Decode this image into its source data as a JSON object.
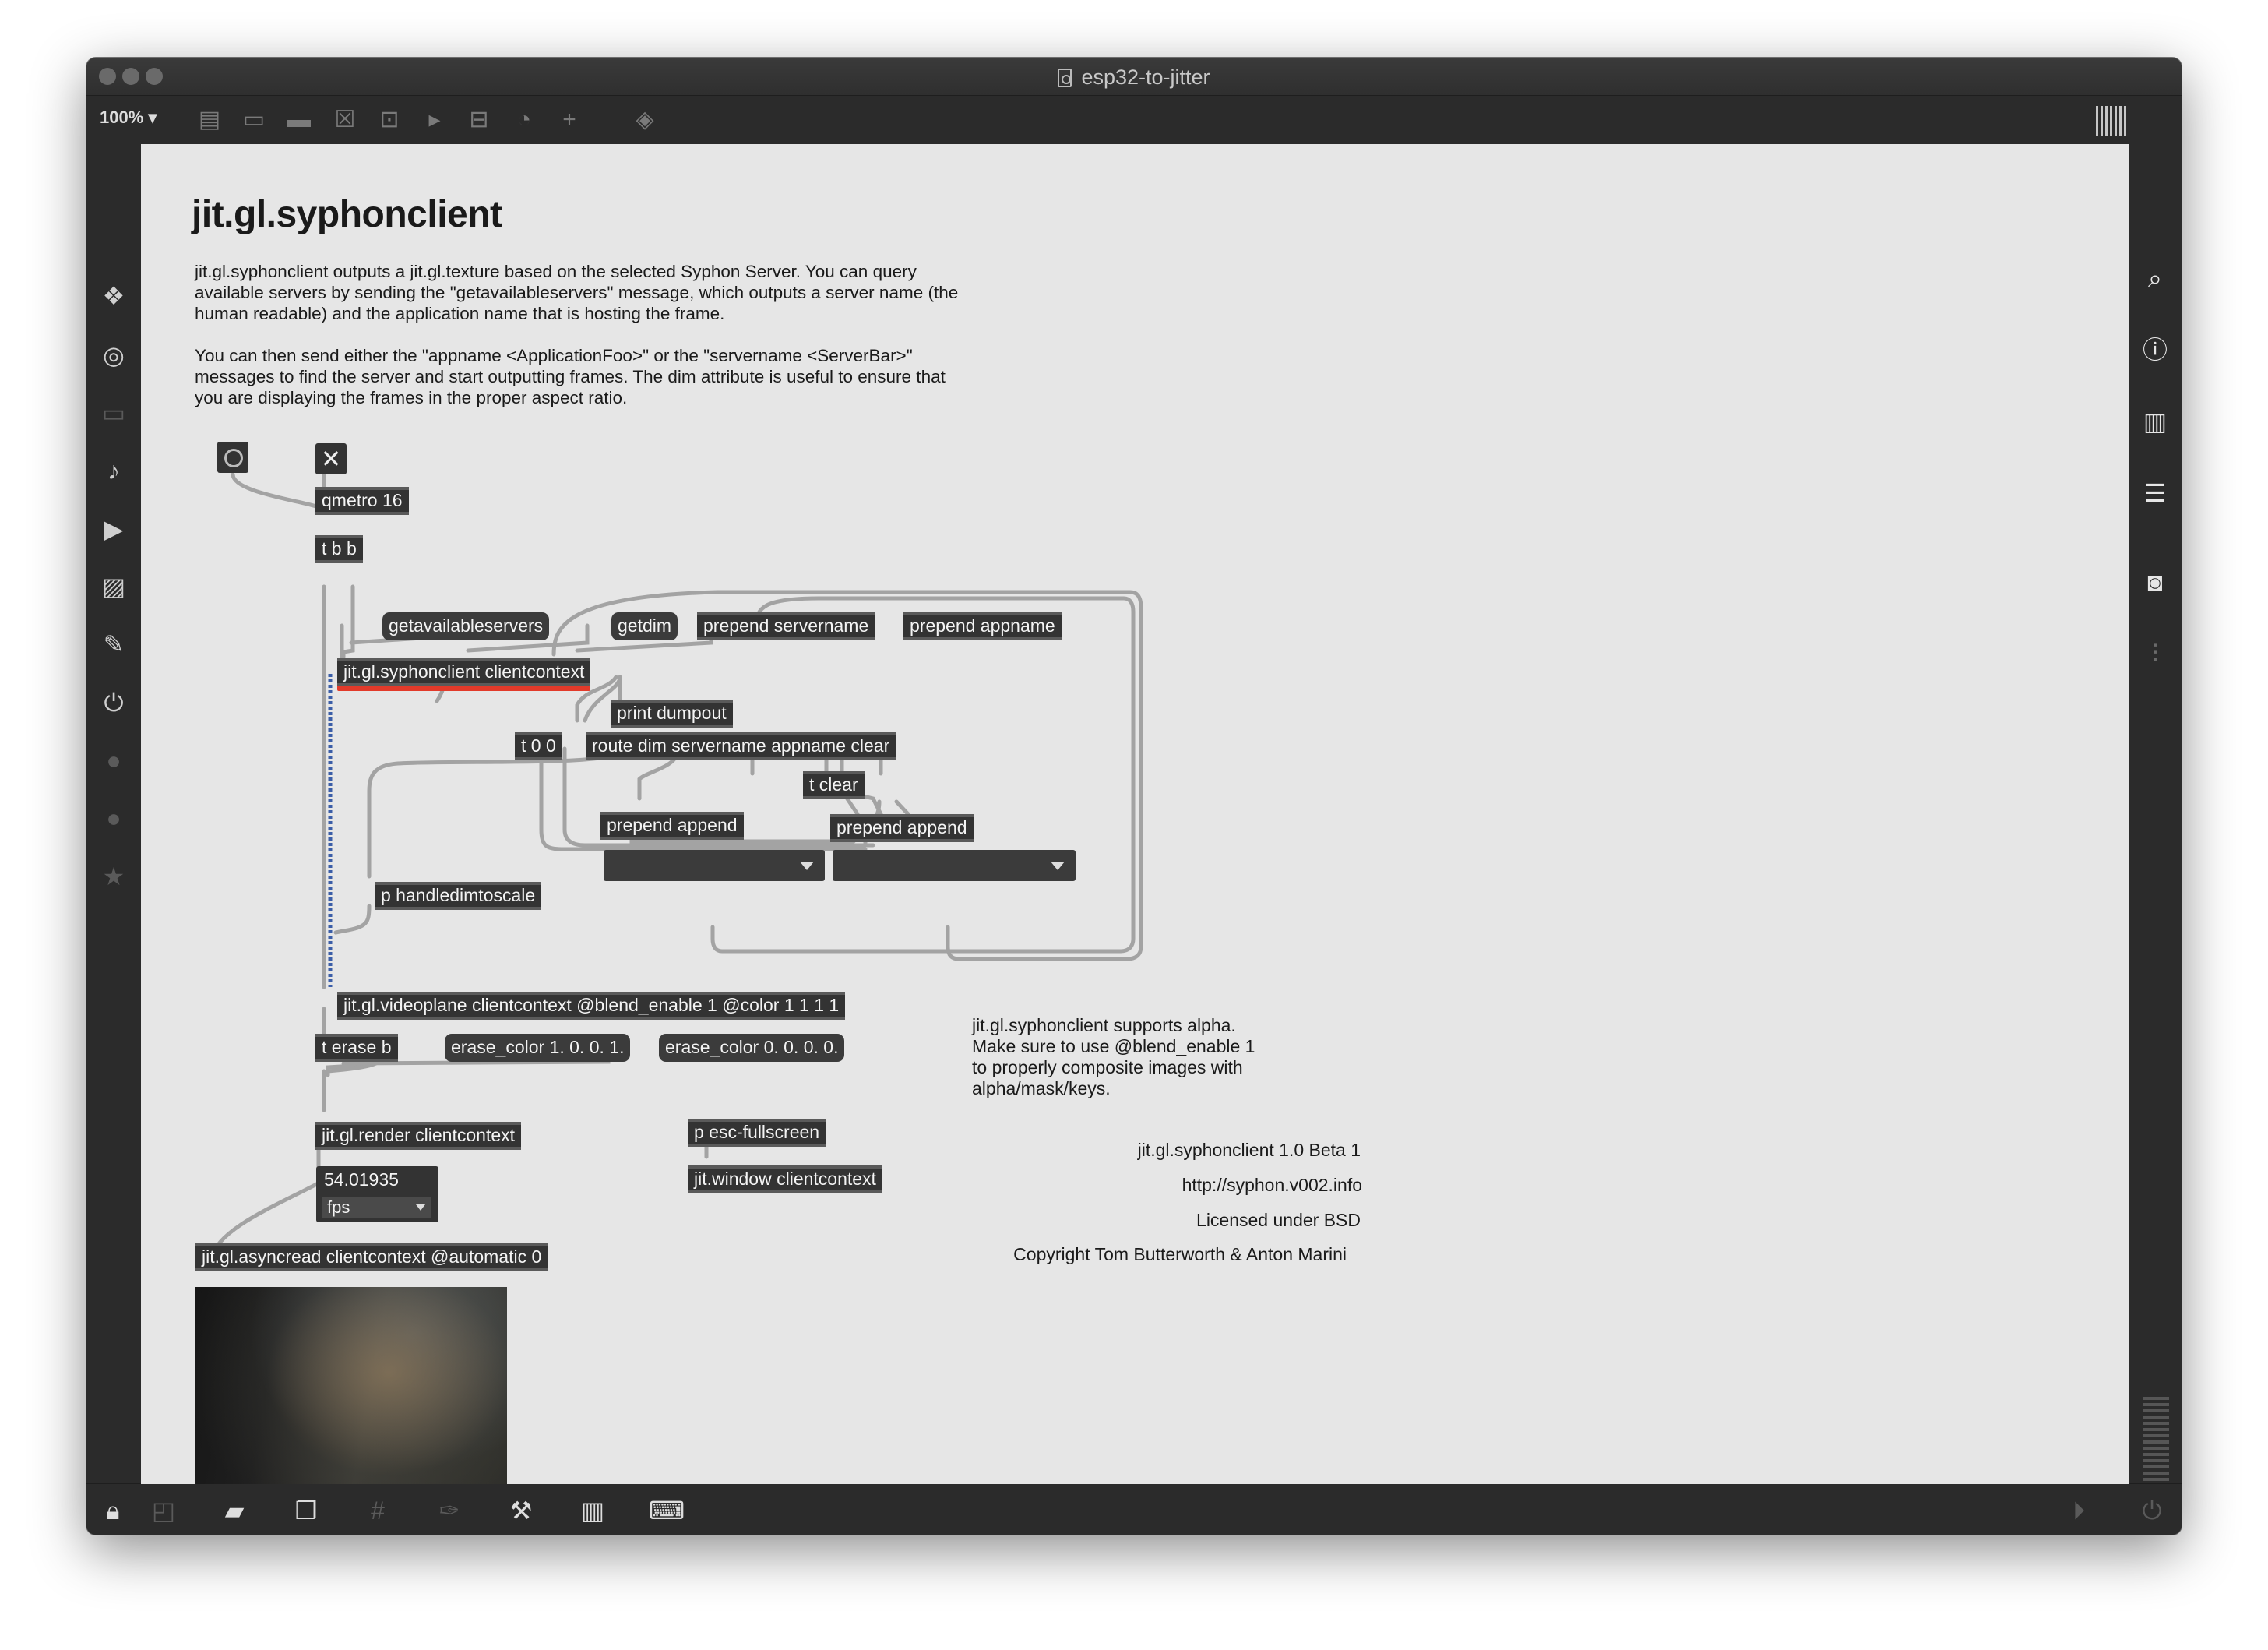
{
  "window": {
    "title": "esp32-to-jitter",
    "zoom": "100%"
  },
  "patcher": {
    "heading": "jit.gl.syphonclient",
    "description_1": "jit.gl.syphonclient outputs a jit.gl.texture based on the selected Syphon Server. You can query available servers by sending the \"getavailableservers\" message, which outputs a server name (the human readable) and the application name that is hosting the frame.",
    "description_2": "You can then send either the \"appname <ApplicationFoo>\" or the \"servername <ServerBar>\" messages to find the server and start outputting frames. The dim attribute is useful to ensure that you are displaying the frames in the proper aspect ratio.",
    "objects": {
      "qmetro": "qmetro 16",
      "tbb": "t b b",
      "getavailableservers": "getavailableservers",
      "getdim": "getdim",
      "prepend_servername": "prepend servername",
      "prepend_appname": "prepend appname",
      "syphonclient": "jit.gl.syphonclient clientcontext",
      "print_dumpout": "print dumpout",
      "t00": "t 0 0",
      "route": "route dim servername appname clear",
      "tclear": "t clear",
      "prepend_append_1": "prepend append",
      "prepend_append_2": "prepend append",
      "handledimtoscale": "p handledimtoscale",
      "videoplane": "jit.gl.videoplane clientcontext @blend_enable 1 @color 1 1 1 1",
      "terase": "t erase b",
      "erase_color_1": "erase_color 1. 0. 0. 1.",
      "erase_color_0": "erase_color 0. 0. 0. 0.",
      "render": "jit.gl.render clientcontext",
      "esc_fullscreen": "p esc-fullscreen",
      "window": "jit.window clientcontext",
      "asyncread": "jit.gl.asyncread clientcontext @automatic 0"
    },
    "fps": {
      "value": "54.01935",
      "unit": "fps"
    },
    "alpha_note": "jit.gl.syphonclient supports alpha.\nMake sure to use @blend_enable 1\nto properly composite images with\nalpha/mask/keys.",
    "credits": {
      "version": "jit.gl.syphonclient 1.0 Beta 1",
      "url": "http://syphon.v002.info",
      "license": "Licensed under BSD",
      "copyright": "Copyright Tom Butterworth & Anton Marini"
    }
  },
  "icons": {
    "left_sidebar": [
      "package-icon",
      "target-icon",
      "film-icon",
      "music-note-icon",
      "video-play-icon",
      "image-icon",
      "paperclip-icon",
      "plug-icon",
      "vimeo-icon",
      "pinterest-icon",
      "star-icon"
    ],
    "right_sidebar": [
      "search-icon",
      "info-icon",
      "book-icon",
      "list-icon",
      "camera-icon",
      "mixer-icon"
    ],
    "bottom_bar": [
      "lock-icon",
      "edit-icon",
      "presentation-icon",
      "windows-icon",
      "grid-icon",
      "paint-icon",
      "wrench-icon",
      "piano-icon",
      "keyboard-icon",
      "play-icon",
      "power-icon"
    ]
  },
  "colors": {
    "canvas_bg": "#e6e6e6",
    "object_bg": "#333333",
    "selected_outline": "#e23a2a",
    "chrome": "#2b2b2b"
  }
}
